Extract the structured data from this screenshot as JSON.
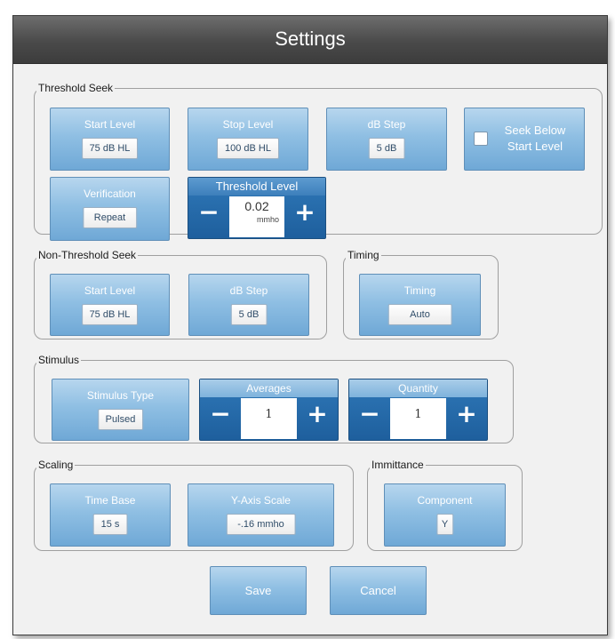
{
  "window": {
    "title": "Settings"
  },
  "threshold_seek": {
    "legend": "Threshold Seek",
    "start_level": {
      "label": "Start Level",
      "value": "75 dB HL"
    },
    "stop_level": {
      "label": "Stop Level",
      "value": "100 dB HL"
    },
    "db_step": {
      "label": "dB Step",
      "value": "5 dB"
    },
    "seek_below": {
      "label_line1": "Seek Below",
      "label_line2": "Start Level",
      "checked": false
    },
    "verification": {
      "label": "Verification",
      "value": "Repeat"
    },
    "threshold_level": {
      "label": "Threshold Level",
      "value": "0.02",
      "unit": "mmho",
      "minus": "−",
      "plus": "+"
    }
  },
  "non_threshold_seek": {
    "legend": "Non-Threshold Seek",
    "start_level": {
      "label": "Start Level",
      "value": "75 dB HL"
    },
    "db_step": {
      "label": "dB Step",
      "value": "5 dB"
    }
  },
  "timing": {
    "legend": "Timing",
    "timing": {
      "label": "Timing",
      "value": "Auto"
    }
  },
  "stimulus": {
    "legend": "Stimulus",
    "stimulus_type": {
      "label": "Stimulus Type",
      "value": "Pulsed"
    },
    "averages": {
      "label": "Averages",
      "value": "1",
      "minus": "−",
      "plus": "+"
    },
    "quantity": {
      "label": "Quantity",
      "value": "1",
      "minus": "−",
      "plus": "+"
    }
  },
  "scaling": {
    "legend": "Scaling",
    "time_base": {
      "label": "Time Base",
      "value": "15 s"
    },
    "y_axis_scale": {
      "label": "Y-Axis Scale",
      "value": "-.16 mmho"
    }
  },
  "immittance": {
    "legend": "Immittance",
    "component": {
      "label": "Component",
      "value": "Y"
    }
  },
  "actions": {
    "save": "Save",
    "cancel": "Cancel"
  }
}
